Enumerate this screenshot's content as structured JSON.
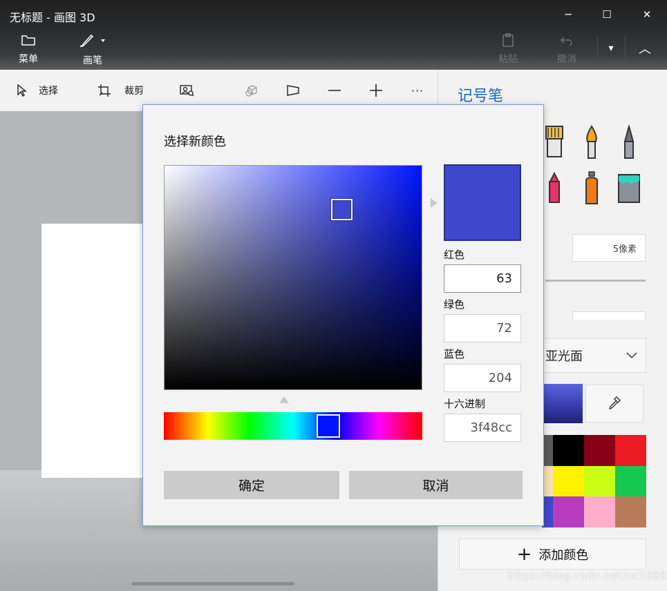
{
  "window": {
    "title": "无标题 - 画图 3D",
    "minimize_glyph": "─",
    "maximize_glyph": "☐",
    "close_glyph": "✕"
  },
  "ribbon": {
    "menu_label": "菜单",
    "brush_label": "画笔",
    "paste_label": "粘贴",
    "undo_label": "撤消",
    "more_glyph": "▾",
    "collapse_glyph": "︿"
  },
  "toolbar": {
    "select_label": "选择",
    "crop_label": "裁剪",
    "more_glyph": "···"
  },
  "panel": {
    "title": "记号笔",
    "thickness_value": "5像素",
    "finish_value": "亚光面",
    "current_color": "#3f48cc",
    "palette": [
      "#5b5b5b",
      "#000000",
      "#880015",
      "#ed1c24",
      "#f5dfb5",
      "#fff200",
      "#c8ff14",
      "#16c850",
      "#3f48cc",
      "#b83cc0",
      "#ffaec9",
      "#b97a57"
    ],
    "add_color_label": "添加颜色",
    "watermark": "https://blog.csdn.net/nc1988210"
  },
  "dialog": {
    "title": "选择新颜色",
    "selected_color": "#3f48cc",
    "red_label": "红色",
    "red_value": "63",
    "green_label": "绿色",
    "green_value": "72",
    "blue_label": "蓝色",
    "blue_value": "204",
    "hex_label": "十六进制",
    "hex_value": "3f48cc",
    "ok_label": "确定",
    "cancel_label": "取消"
  }
}
